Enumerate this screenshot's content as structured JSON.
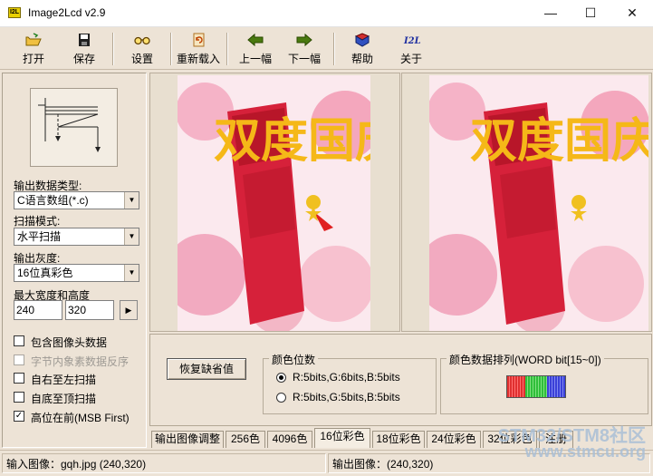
{
  "window": {
    "title": "Image2Lcd v2.9",
    "icon_text": "I2L"
  },
  "toolbar": {
    "buttons": [
      {
        "id": "open",
        "label": "打开",
        "icon": "open-folder-icon"
      },
      {
        "id": "save",
        "label": "保存",
        "icon": "floppy-disk-icon"
      },
      {
        "id": "settings",
        "label": "设置",
        "icon": "glasses-icon"
      },
      {
        "id": "reload",
        "label": "重新载入",
        "icon": "reload-icon"
      },
      {
        "id": "prev",
        "label": "上一幅",
        "icon": "arrow-left-icon"
      },
      {
        "id": "next",
        "label": "下一幅",
        "icon": "arrow-right-icon"
      },
      {
        "id": "help",
        "label": "帮助",
        "icon": "help-book-icon"
      },
      {
        "id": "about",
        "label": "关于",
        "icon": "i2l-logo-icon"
      }
    ]
  },
  "left": {
    "output_type_label": "输出数据类型:",
    "output_type_value": "C语言数组(*.c)",
    "scan_mode_label": "扫描模式:",
    "scan_mode_value": "水平扫描",
    "gray_label": "输出灰度:",
    "gray_value": "16位真彩色",
    "size_label": "最大宽度和高度",
    "width": "240",
    "height": "320",
    "checkboxes": [
      {
        "label": "包含图像头数据",
        "checked": false,
        "disabled": false
      },
      {
        "label": "字节内象素数据反序",
        "checked": false,
        "disabled": true
      },
      {
        "label": "自右至左扫描",
        "checked": false,
        "disabled": false
      },
      {
        "label": "自底至顶扫描",
        "checked": false,
        "disabled": false
      },
      {
        "label": "高位在前(MSB First)",
        "checked": true,
        "disabled": false
      }
    ]
  },
  "preview": {
    "input_image_caption": "双度国庆 HAPPY NATION'S DAY",
    "output_image_caption": "双度国庆 HAPPY NATION'S DAY"
  },
  "bottom": {
    "restore_default": "恢复缺省值",
    "color_bits_title": "颜色位数",
    "radio_565": "R:5bits,G:6bits,B:5bits",
    "radio_555": "R:5bits,G:5bits,B:5bits",
    "color_order_title": "颜色数据排列(WORD bit[15~0])",
    "tabs": [
      "输出图像调整",
      "256色",
      "4096色",
      "16位彩色",
      "18位彩色",
      "24位彩色",
      "32位彩色",
      "注册"
    ],
    "active_tab": 3
  },
  "status": {
    "input": "输入图像：gqh.jpg (240,320)",
    "output": "输出图像：(240,320)"
  },
  "watermark": {
    "line1": "STM32/STM8社区",
    "line2": "www.stmcu.org"
  },
  "colors": {
    "accent_red": "#e03030",
    "bar_green": "#2fbf3a",
    "bar_blue": "#3a40d8"
  }
}
